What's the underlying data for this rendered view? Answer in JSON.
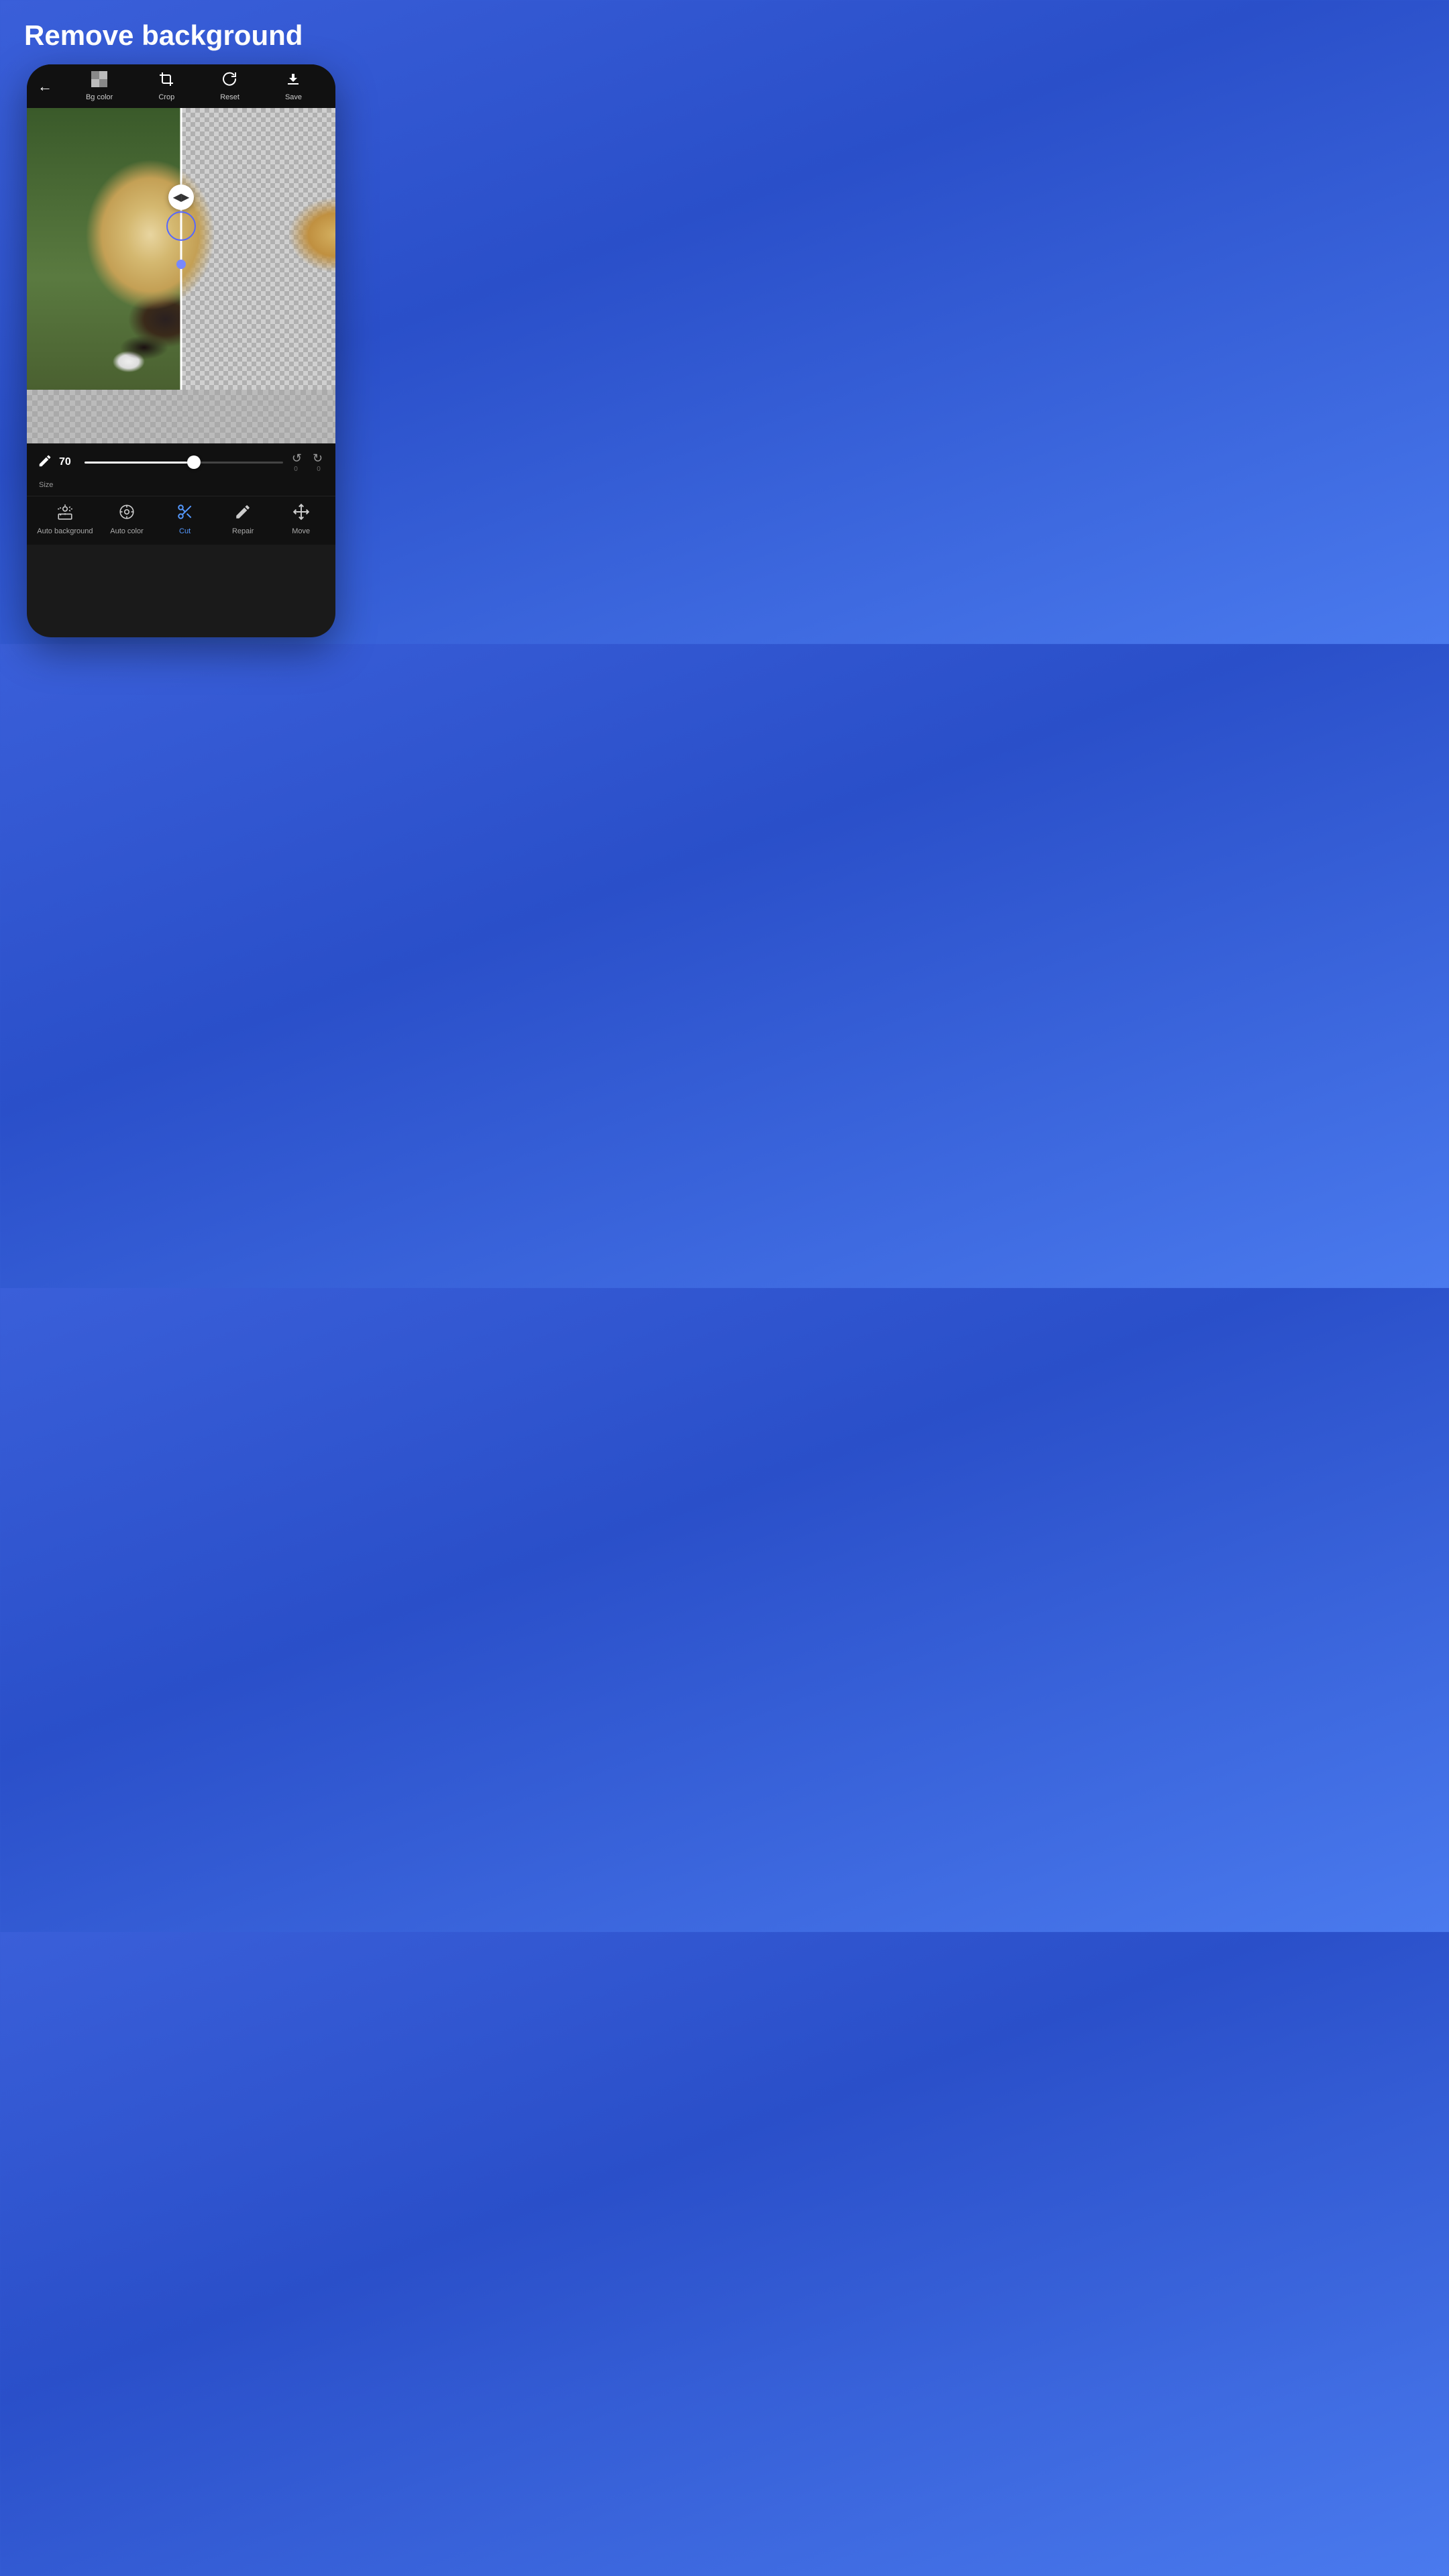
{
  "page": {
    "title": "Remove background",
    "background_gradient": "linear-gradient(160deg, #3a5fd9 0%, #2a4fc9 40%, #4a7aee 100%)"
  },
  "toolbar": {
    "back_label": "←",
    "items": [
      {
        "id": "bg-color",
        "label": "Bg color",
        "icon": "checkerboard"
      },
      {
        "id": "crop",
        "label": "Crop",
        "icon": "crop"
      },
      {
        "id": "reset",
        "label": "Reset",
        "icon": "reset"
      },
      {
        "id": "save",
        "label": "Save",
        "icon": "save"
      }
    ]
  },
  "image": {
    "divider_position": "50%",
    "left_side": "original",
    "right_side": "transparent"
  },
  "size_control": {
    "label": "Size",
    "value": 70,
    "min": 0,
    "max": 100,
    "slider_percent": 55
  },
  "history": {
    "undo_count": 0,
    "redo_count": 0
  },
  "bottom_tools": [
    {
      "id": "auto-background",
      "label": "Auto background",
      "icon": "auto-bg",
      "active": false
    },
    {
      "id": "auto-color",
      "label": "Auto color",
      "icon": "auto-color",
      "active": false
    },
    {
      "id": "cut",
      "label": "Cut",
      "icon": "cut",
      "active": true
    },
    {
      "id": "repair",
      "label": "Repair",
      "icon": "repair",
      "active": false
    },
    {
      "id": "move",
      "label": "Move",
      "icon": "move",
      "active": false
    }
  ]
}
